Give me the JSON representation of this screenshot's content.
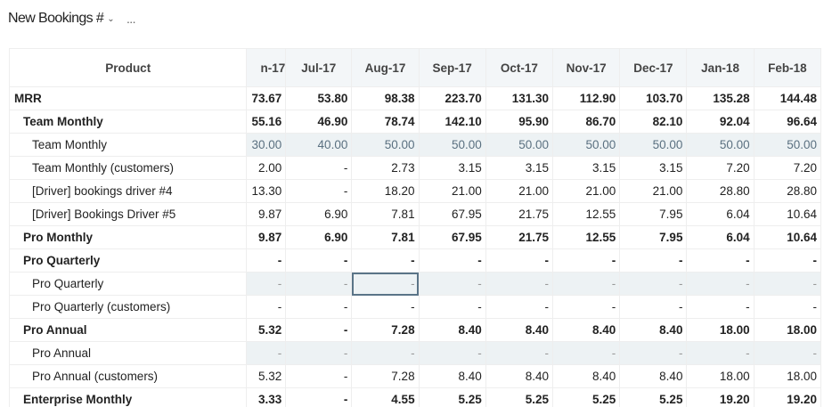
{
  "header": {
    "title": "New Bookings #",
    "more": "..."
  },
  "columns": {
    "product": "Product",
    "months": [
      "n-17",
      "Jul-17",
      "Aug-17",
      "Sep-17",
      "Oct-17",
      "Nov-17",
      "Dec-17",
      "Jan-18",
      "Feb-18"
    ]
  },
  "rows": [
    {
      "label": "MRR",
      "level": 0,
      "input": false,
      "values": [
        "73.67",
        "53.80",
        "98.38",
        "223.70",
        "131.30",
        "112.90",
        "103.70",
        "135.28",
        "144.48"
      ]
    },
    {
      "label": "Team Monthly",
      "level": 1,
      "input": false,
      "values": [
        "55.16",
        "46.90",
        "78.74",
        "142.10",
        "95.90",
        "86.70",
        "82.10",
        "92.04",
        "96.64"
      ]
    },
    {
      "label": "Team Monthly",
      "level": 2,
      "input": true,
      "values": [
        "30.00",
        "40.00",
        "50.00",
        "50.00",
        "50.00",
        "50.00",
        "50.00",
        "50.00",
        "50.00"
      ]
    },
    {
      "label": "Team Monthly (customers)",
      "level": 2,
      "input": false,
      "values": [
        "2.00",
        "-",
        "2.73",
        "3.15",
        "3.15",
        "3.15",
        "3.15",
        "7.20",
        "7.20"
      ]
    },
    {
      "label": "[Driver] bookings driver #4",
      "level": 2,
      "input": false,
      "values": [
        "13.30",
        "-",
        "18.20",
        "21.00",
        "21.00",
        "21.00",
        "21.00",
        "28.80",
        "28.80"
      ]
    },
    {
      "label": "[Driver] Bookings Driver #5",
      "level": 2,
      "input": false,
      "values": [
        "9.87",
        "6.90",
        "7.81",
        "67.95",
        "21.75",
        "12.55",
        "7.95",
        "6.04",
        "10.64"
      ]
    },
    {
      "label": "Pro Monthly",
      "level": 1,
      "input": false,
      "values": [
        "9.87",
        "6.90",
        "7.81",
        "67.95",
        "21.75",
        "12.55",
        "7.95",
        "6.04",
        "10.64"
      ]
    },
    {
      "label": "Pro Quarterly",
      "level": 1,
      "input": false,
      "values": [
        "-",
        "-",
        "-",
        "-",
        "-",
        "-",
        "-",
        "-",
        "-"
      ]
    },
    {
      "label": "Pro Quarterly",
      "level": 2,
      "input": true,
      "values": [
        "-",
        "-",
        "-",
        "-",
        "-",
        "-",
        "-",
        "-",
        "-"
      ],
      "selected": 2
    },
    {
      "label": "Pro Quarterly (customers)",
      "level": 2,
      "input": false,
      "values": [
        "-",
        "-",
        "-",
        "-",
        "-",
        "-",
        "-",
        "-",
        "-"
      ]
    },
    {
      "label": "Pro Annual",
      "level": 1,
      "input": false,
      "values": [
        "5.32",
        "-",
        "7.28",
        "8.40",
        "8.40",
        "8.40",
        "8.40",
        "18.00",
        "18.00"
      ]
    },
    {
      "label": "Pro Annual",
      "level": 2,
      "input": true,
      "values": [
        "-",
        "-",
        "-",
        "-",
        "-",
        "-",
        "-",
        "-",
        "-"
      ]
    },
    {
      "label": "Pro Annual (customers)",
      "level": 2,
      "input": false,
      "values": [
        "5.32",
        "-",
        "7.28",
        "8.40",
        "8.40",
        "8.40",
        "8.40",
        "18.00",
        "18.00"
      ]
    },
    {
      "label": "Enterprise Monthly",
      "level": 1,
      "input": false,
      "values": [
        "3.33",
        "-",
        "4.55",
        "5.25",
        "5.25",
        "5.25",
        "5.25",
        "19.20",
        "19.20"
      ]
    }
  ]
}
